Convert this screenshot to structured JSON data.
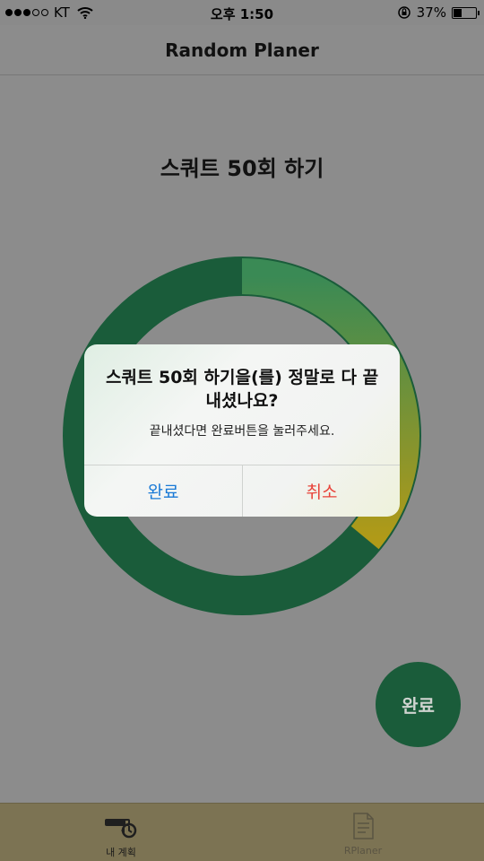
{
  "status_bar": {
    "carrier": "KT",
    "time": "오후 1:50",
    "battery_percent": "37%",
    "signal_bars_filled": 3,
    "signal_bars_total": 5
  },
  "nav": {
    "title": "Random Planer"
  },
  "task": {
    "title": "스쿼트 50회 하기"
  },
  "progress": {
    "elapsed_fraction": 0.36,
    "ring_color": "#1a5c3a",
    "elapsed_start_color": "#3a8a55",
    "elapsed_end_color": "#b09a18"
  },
  "fab": {
    "label": "완료"
  },
  "alert": {
    "title": "스쿼트 50회 하기을(를) 정말로 다 끝내셨나요?",
    "message": "끝내셨다면 완료버튼을 눌러주세요.",
    "confirm_label": "완료",
    "cancel_label": "취소"
  },
  "tabs": [
    {
      "label": "내 계획",
      "icon": "plan-timer-icon",
      "active": true
    },
    {
      "label": "RPlaner",
      "icon": "document-checklist-icon",
      "active": false
    }
  ],
  "colors": {
    "overlay_bg": "#8c8c8c",
    "accent_green": "#1a5c3a",
    "tab_bar_bg": "#7c7353",
    "confirm_blue": "#1a7ad6",
    "cancel_red": "#e8433a"
  }
}
